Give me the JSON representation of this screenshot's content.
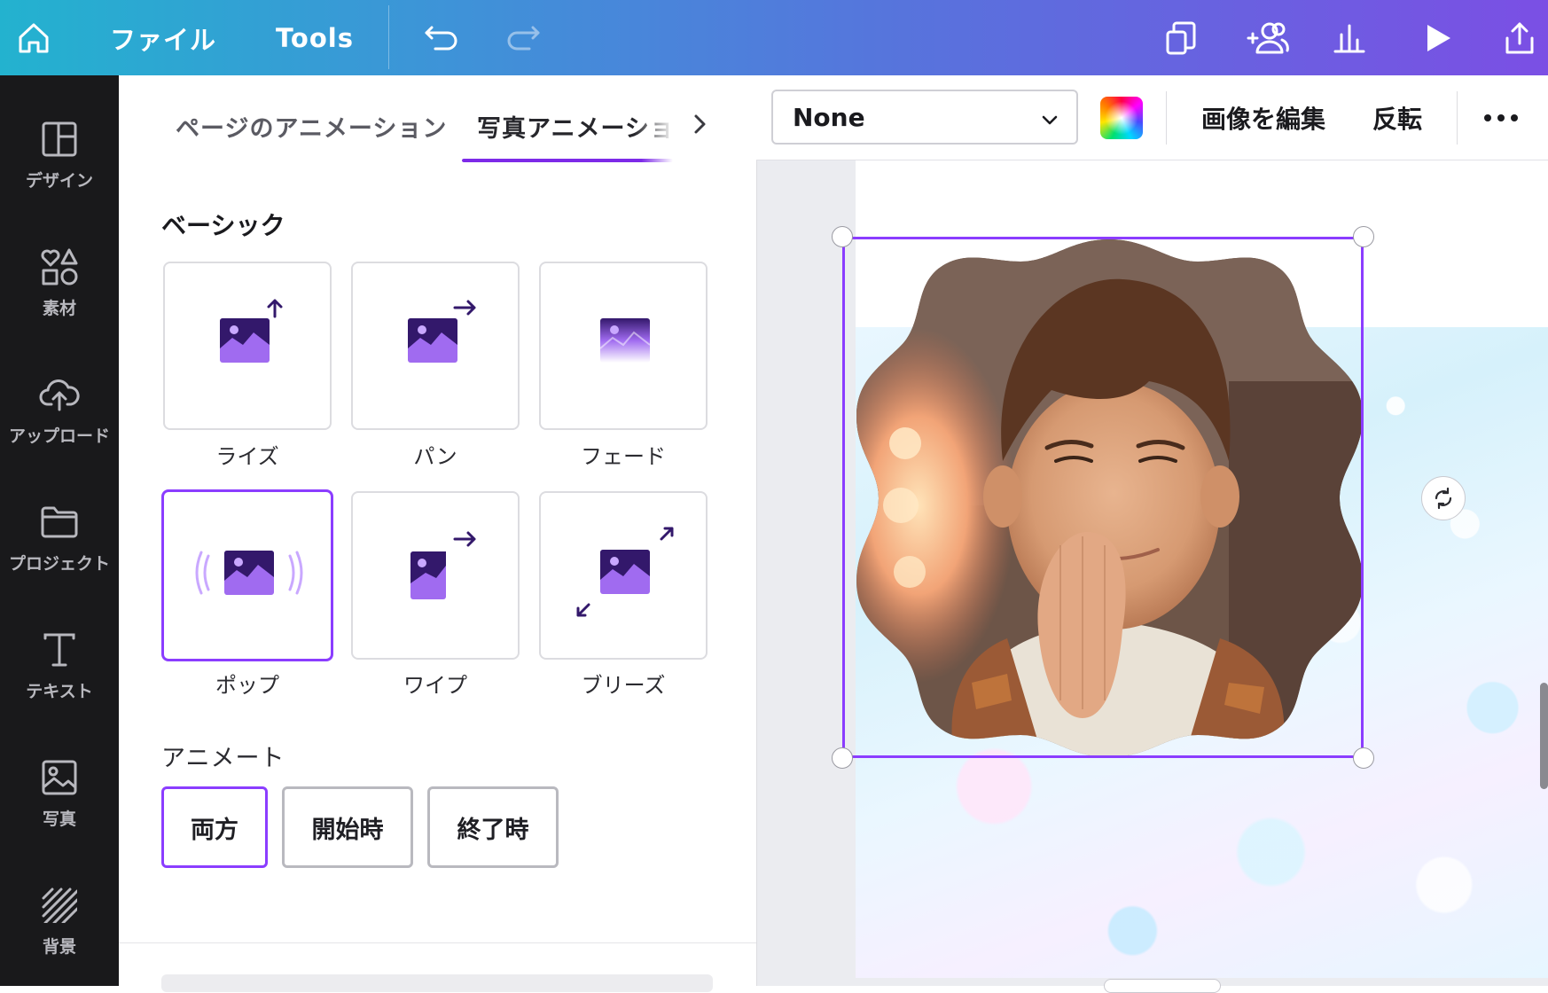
{
  "topbar": {
    "home_icon": "home-icon",
    "file_label": "ファイル",
    "tools_label": "Tools",
    "undo_icon": "undo-icon",
    "redo_icon": "redo-icon",
    "right_icons": [
      "copy-pages-icon",
      "add-people-icon",
      "chart-icon",
      "play-icon",
      "share-icon"
    ]
  },
  "rail": {
    "items": [
      {
        "label": "デザイン",
        "icon": "layout-icon"
      },
      {
        "label": "素材",
        "icon": "shapes-icon"
      },
      {
        "label": "アップロード",
        "icon": "cloud-upload-icon"
      },
      {
        "label": "プロジェクト",
        "icon": "folder-icon"
      },
      {
        "label": "テキスト",
        "icon": "text-icon"
      },
      {
        "label": "写真",
        "icon": "photo-icon"
      },
      {
        "label": "背景",
        "icon": "background-pattern-icon"
      }
    ]
  },
  "panel": {
    "tabs": [
      {
        "label": "ページのアニメーション",
        "active": false
      },
      {
        "label": "写真アニメーション",
        "active": true
      }
    ],
    "section_title": "ベーシック",
    "animations": [
      {
        "label": "ライズ",
        "selected": false
      },
      {
        "label": "パン",
        "selected": false
      },
      {
        "label": "フェード",
        "selected": false
      },
      {
        "label": "ポップ",
        "selected": true
      },
      {
        "label": "ワイプ",
        "selected": false
      },
      {
        "label": "ブリーズ",
        "selected": false
      }
    ],
    "animate_title": "アニメート",
    "animate_options": [
      {
        "label": "両方",
        "selected": true
      },
      {
        "label": "開始時",
        "selected": false
      },
      {
        "label": "終了時",
        "selected": false
      }
    ]
  },
  "context_bar": {
    "dropdown_value": "None",
    "edit_image_label": "画像を編集",
    "flip_label": "反転",
    "more_icon": "more-icon"
  },
  "colors": {
    "accent": "#8b3dff",
    "topbar_start": "#23b2cf",
    "topbar_end": "#7b4fe4",
    "rail_bg": "#19191b"
  }
}
